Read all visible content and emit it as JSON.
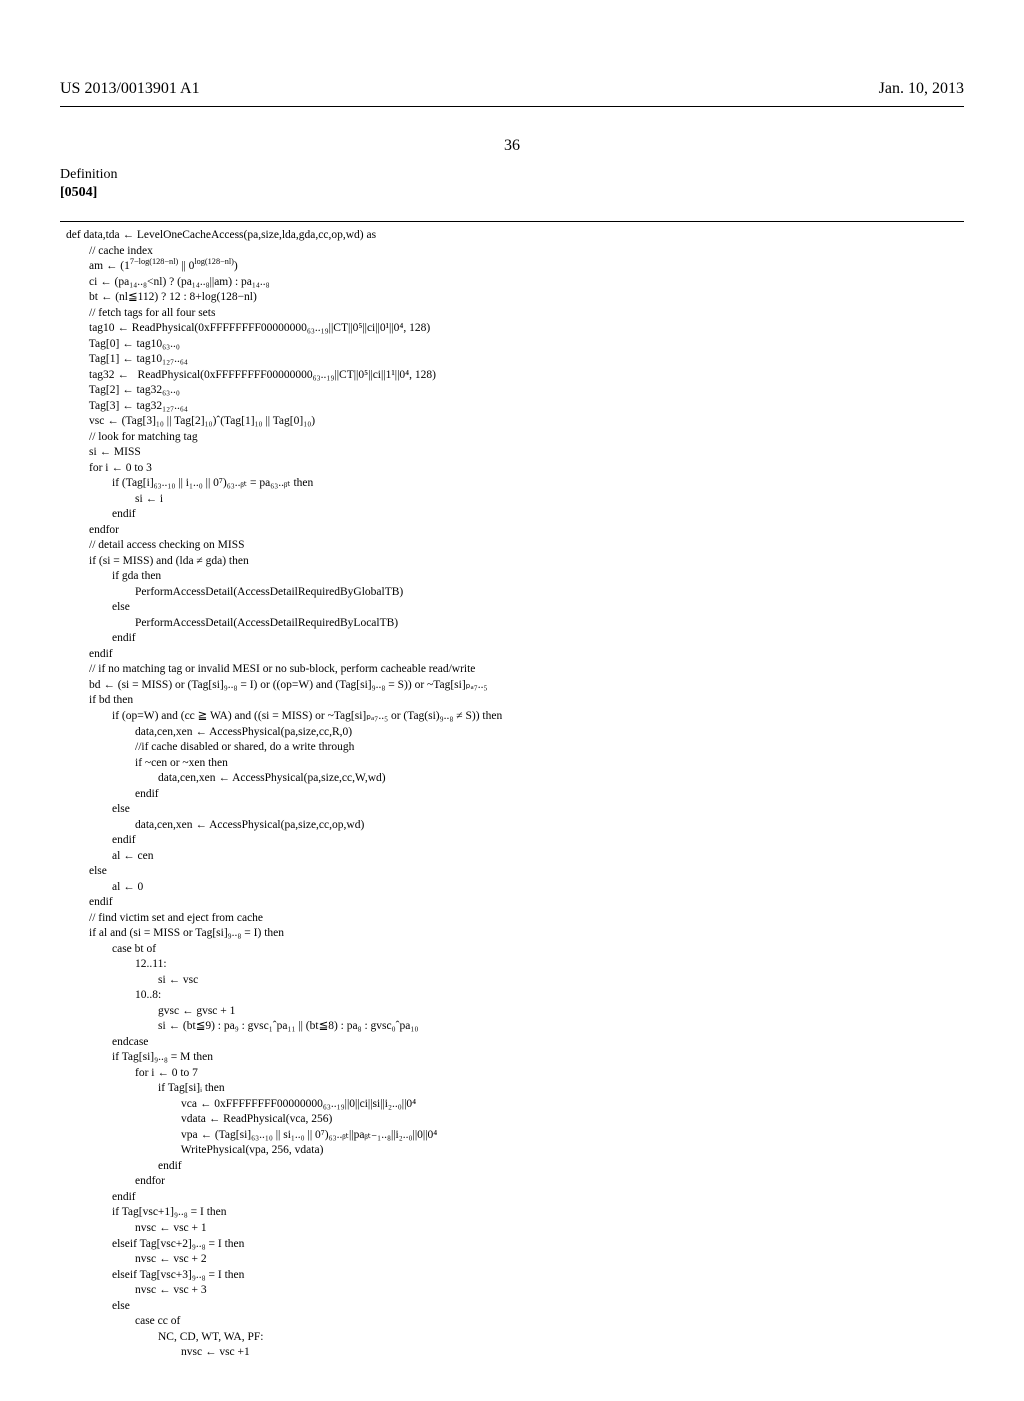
{
  "header": {
    "pub_number": "US 2013/0013901 A1",
    "date": "Jan. 10, 2013"
  },
  "page_number": "36",
  "section": {
    "title": "Definition",
    "para_label": "[0504]"
  },
  "code": {
    "l01": "def data,tda ← LevelOneCacheAccess(pa,size,lda,gda,cc,op,wd) as",
    "l02": "        // cache index",
    "l03a": "        am ← (1",
    "l03b": "7−log(128−nl)",
    "l03c": " || 0",
    "l03d": "log(128−nl)",
    "l03e": ")",
    "l04": "        ci ← (pa₁₄..₈<nl) ? (pa₁₄..₈||am) : pa₁₄..₈",
    "l05": "        bt ← (nl≦112) ? 12 : 8+log(128−nl)",
    "l06": "        // fetch tags for all four sets",
    "l07": "        tag10 ← ReadPhysical(0xFFFFFFFF00000000₆₃..₁₉||CT||0⁵||ci||0¹||0⁴, 128)",
    "l08": "        Tag[0] ← tag10₆₃..₀",
    "l09": "        Tag[1] ← tag10₁₂₇..₆₄",
    "l10": "        tag32 ←   ReadPhysical(0xFFFFFFFF00000000₆₃..₁₉||CT||0⁵||ci||1¹||0⁴, 128)",
    "l11": "        Tag[2] ← tag32₆₃..₀",
    "l12": "        Tag[3] ← tag32₁₂₇..₆₄",
    "l13": "        vsc ← (Tag[3]₁₀ || Tag[2]₁₀)ˆ(Tag[1]₁₀ || Tag[0]₁₀)",
    "l14": "        // look for matching tag",
    "l15": "        si ← MISS",
    "l16": "        for i ← 0 to 3",
    "l17": "                if (Tag[i]₆₃..₁₀ || i₁..₀ || 0⁷)₆₃..ᵦₜ = pa₆₃..ᵦₜ then",
    "l18": "                        si ← i",
    "l19": "                endif",
    "l20": "        endfor",
    "l21": "        // detail access checking on MISS",
    "l22": "        if (si = MISS) and (lda ≠ gda) then",
    "l23": "                if gda then",
    "l24": "                        PerformAccessDetail(AccessDetailRequiredByGlobalTB)",
    "l25": "                else",
    "l26": "                        PerformAccessDetail(AccessDetailRequiredByLocalTB)",
    "l27": "                endif",
    "l28": "        endif",
    "l29": "        // if no matching tag or invalid MESI or no sub-block, perform cacheable read/write",
    "l30": "        bd ← (si = MISS) or (Tag[si]₉..₈ = I) or ((op=W) and (Tag[si]₉..₈ = S)) or ~Tag[si]ₚₐ₇..₅",
    "l31": "        if bd then",
    "l32": "                if (op=W) and (cc ≧ WA) and ((si = MISS) or ~Tag[si]ₚₐ₇..₅ or (Tag(si)₉..₈ ≠ S)) then",
    "l33": "                        data,cen,xen ← AccessPhysical(pa,size,cc,R,0)",
    "l34": "                        //if cache disabled or shared, do a write through",
    "l35": "                        if ~cen or ~xen then",
    "l36": "                                data,cen,xen ← AccessPhysical(pa,size,cc,W,wd)",
    "l37": "                        endif",
    "l38": "                else",
    "l39": "                        data,cen,xen ← AccessPhysical(pa,size,cc,op,wd)",
    "l40": "                endif",
    "l41": "                al ← cen",
    "l42": "        else",
    "l43": "                al ← 0",
    "l44": "        endif",
    "l45": "        // find victim set and eject from cache",
    "l46": "        if al and (si = MISS or Tag[si]₉..₈ = I) then",
    "l47": "                case bt of",
    "l48": "                        12..11:",
    "l49": "                                si ← vsc",
    "l50": "                        10..8:",
    "l51": "                                gvsc ← gvsc + 1",
    "l52": "                                si ← (bt≦9) : pa₉ : gvsc₁ˆpa₁₁ || (bt≦8) : pa₈ : gvsc₀ˆpa₁₀",
    "l53": "                endcase",
    "l54": "                if Tag[si]₉..₈ = M then",
    "l55": "                        for i ← 0 to 7",
    "l56": "                                if Tag[si]ᵢ then",
    "l57": "                                        vca ← 0xFFFFFFFF00000000₆₃..₁₉||0||ci||si||i₂..₀||0⁴",
    "l58": "                                        vdata ← ReadPhysical(vca, 256)",
    "l59": "                                        vpa ← (Tag[si]₆₃..₁₀ || si₁..₀ || 0⁷)₆₃..ᵦₜ||paᵦₜ₋₁..₈||i₂..₀||0||0⁴",
    "l60": "                                        WritePhysical(vpa, 256, vdata)",
    "l61": "                                endif",
    "l62": "                        endfor",
    "l63": "                endif",
    "l64": "                if Tag[vsc+1]₉..₈ = I then",
    "l65": "                        nvsc ← vsc + 1",
    "l66": "                elseif Tag[vsc+2]₉..₈ = I then",
    "l67": "                        nvsc ← vsc + 2",
    "l68": "                elseif Tag[vsc+3]₉..₈ = I then",
    "l69": "                        nvsc ← vsc + 3",
    "l70": "                else",
    "l71": "                        case cc of",
    "l72": "                                NC, CD, WT, WA, PF:",
    "l73": "                                        nvsc ← vsc +1"
  }
}
